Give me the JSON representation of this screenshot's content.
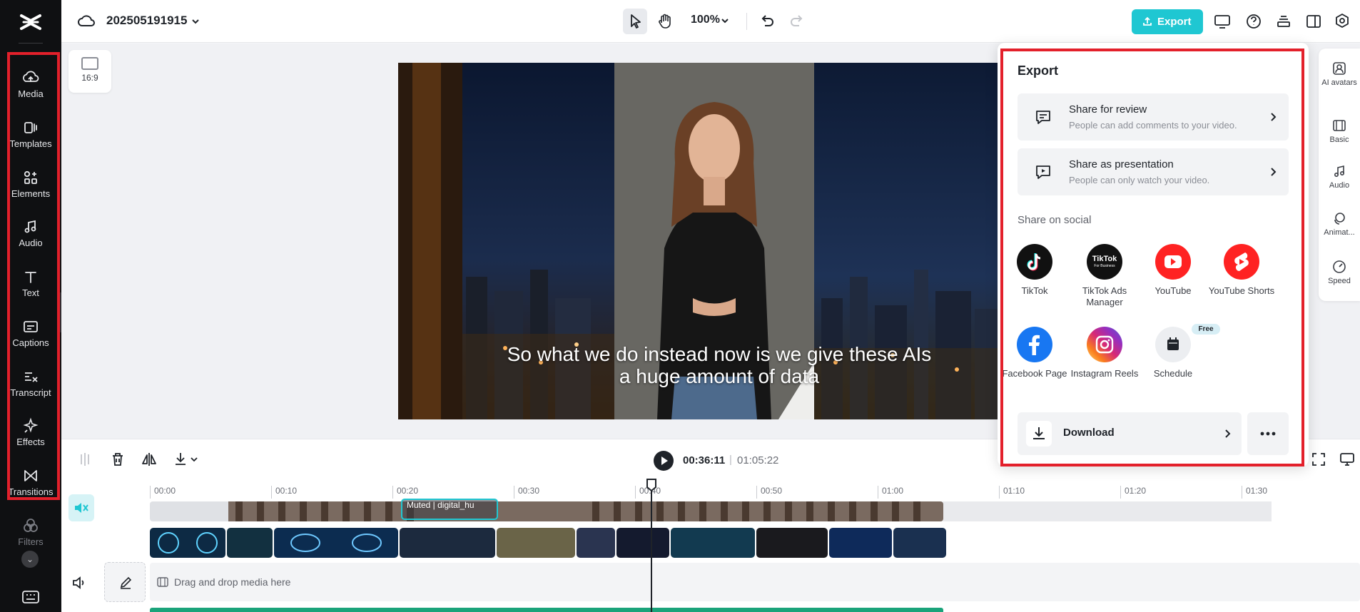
{
  "header": {
    "project_title": "202505191915",
    "zoom_level": "100%",
    "export_label": "Export"
  },
  "sidebar": {
    "items": [
      {
        "label": "Media",
        "icon": "media-cloud-icon"
      },
      {
        "label": "Templates",
        "icon": "templates-icon"
      },
      {
        "label": "Elements",
        "icon": "elements-icon"
      },
      {
        "label": "Audio",
        "icon": "music-note-icon"
      },
      {
        "label": "Text",
        "icon": "text-t-icon"
      },
      {
        "label": "Captions",
        "icon": "captions-icon"
      },
      {
        "label": "Transcript",
        "icon": "transcript-icon"
      },
      {
        "label": "Effects",
        "icon": "effects-sparkle-icon"
      },
      {
        "label": "Transitions",
        "icon": "transitions-bowtie-icon"
      },
      {
        "label": "Filters",
        "icon": "filters-icon"
      }
    ]
  },
  "canvas": {
    "aspect_ratio": "16:9",
    "subtitle_line1": "So what we do instead now is we give these AIs",
    "subtitle_line2": "a huge amount of data"
  },
  "timeline": {
    "current_time": "00:36:11",
    "separator": "|",
    "total_time": "01:05:22",
    "ruler_ticks": [
      "00:00",
      "00:10",
      "00:20",
      "00:30",
      "00:40",
      "00:50",
      "01:00",
      "01:10",
      "01:20",
      "01:30"
    ],
    "muted_clip_label": "Muted | digital_hu",
    "drop_text": "Drag and drop media here"
  },
  "right_panel": {
    "items": [
      {
        "label": "AI avatars"
      },
      {
        "label": "Basic"
      },
      {
        "label": "Audio"
      },
      {
        "label": "Animat..."
      },
      {
        "label": "Speed"
      }
    ]
  },
  "export_panel": {
    "title": "Export",
    "share_review": {
      "title": "Share for review",
      "subtitle": "People can add comments to your video."
    },
    "share_presentation": {
      "title": "Share as presentation",
      "subtitle": "People can only watch your video."
    },
    "social_title": "Share on social",
    "social": [
      {
        "label": "TikTok"
      },
      {
        "label": "TikTok Ads Manager",
        "logo_text": "TikTok",
        "logo_sub": "For Business"
      },
      {
        "label": "YouTube"
      },
      {
        "label": "YouTube Shorts"
      },
      {
        "label": "Facebook Page"
      },
      {
        "label": "Instagram Reels"
      },
      {
        "label": "Schedule",
        "badge": "Free"
      }
    ],
    "download_label": "Download"
  },
  "colors": {
    "accent": "#1fc7d2",
    "highlight_frame": "#e3202b",
    "youtube": "#ff0000",
    "facebook": "#1877f2"
  }
}
